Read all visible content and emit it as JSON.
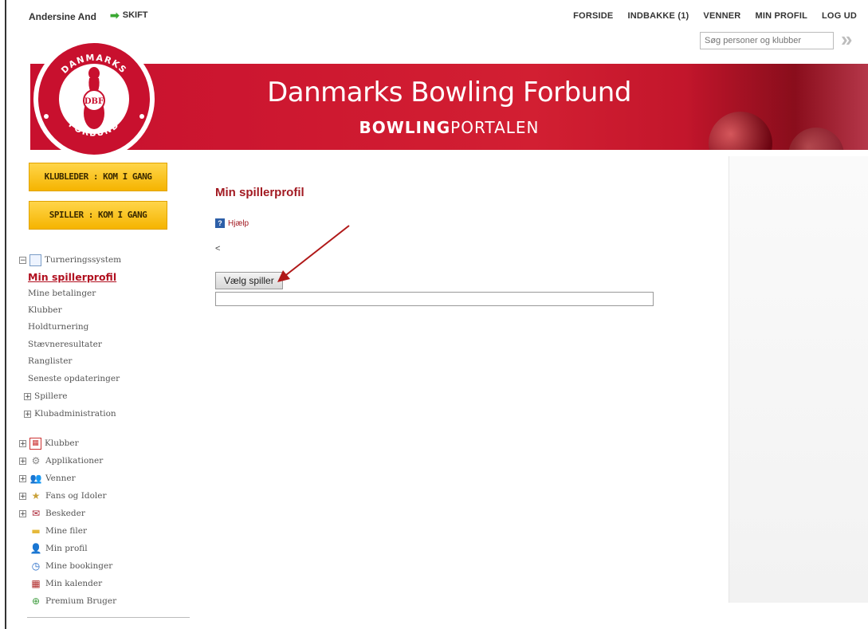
{
  "topbar": {
    "username": "Andersine And",
    "shift_label": "SKIFT",
    "nav": [
      "FORSIDE",
      "INDBAKKE (1)",
      "VENNER",
      "MIN PROFIL",
      "LOG UD"
    ],
    "search_placeholder": "Søg personer og klubber"
  },
  "banner": {
    "title": "Danmarks Bowling Forbund",
    "subtitle_bold": "BOWLING",
    "subtitle_rest": "PORTALEN",
    "logo_text_top": "DANMARKS",
    "logo_text_right": "BOWLING",
    "logo_text_bottom": "FORBUND",
    "logo_monogram": "DBF"
  },
  "sidebar": {
    "button_club": "KLUBLEDER : KOM I GANG",
    "button_player": "SPILLER : KOM I GANG",
    "tree": {
      "root": "Turneringssystem",
      "active": "Min spillerprofil",
      "items": [
        "Mine betalinger",
        "Klubber",
        "Holdturnering",
        "Stævneresultater",
        "Ranglister",
        "Seneste opdateringer"
      ],
      "spillere": "Spillere",
      "klubadmin": "Klubadministration",
      "groups": [
        "Klubber",
        "Applikationer",
        "Venner",
        "Fans og Idoler",
        "Beskeder"
      ],
      "links": [
        "Mine filer",
        "Min profil",
        "Mine bookinger",
        "Min kalender",
        "Premium Bruger"
      ]
    }
  },
  "main": {
    "heading": "Min spillerprofil",
    "help_label": "Hjælp",
    "back_symbol": "<",
    "choose_button": "Vælg spiller",
    "player_field_value": ""
  },
  "colors": {
    "brand_red": "#c8102e",
    "heading_red": "#a21a22",
    "button_yellow": "#f5b400"
  }
}
